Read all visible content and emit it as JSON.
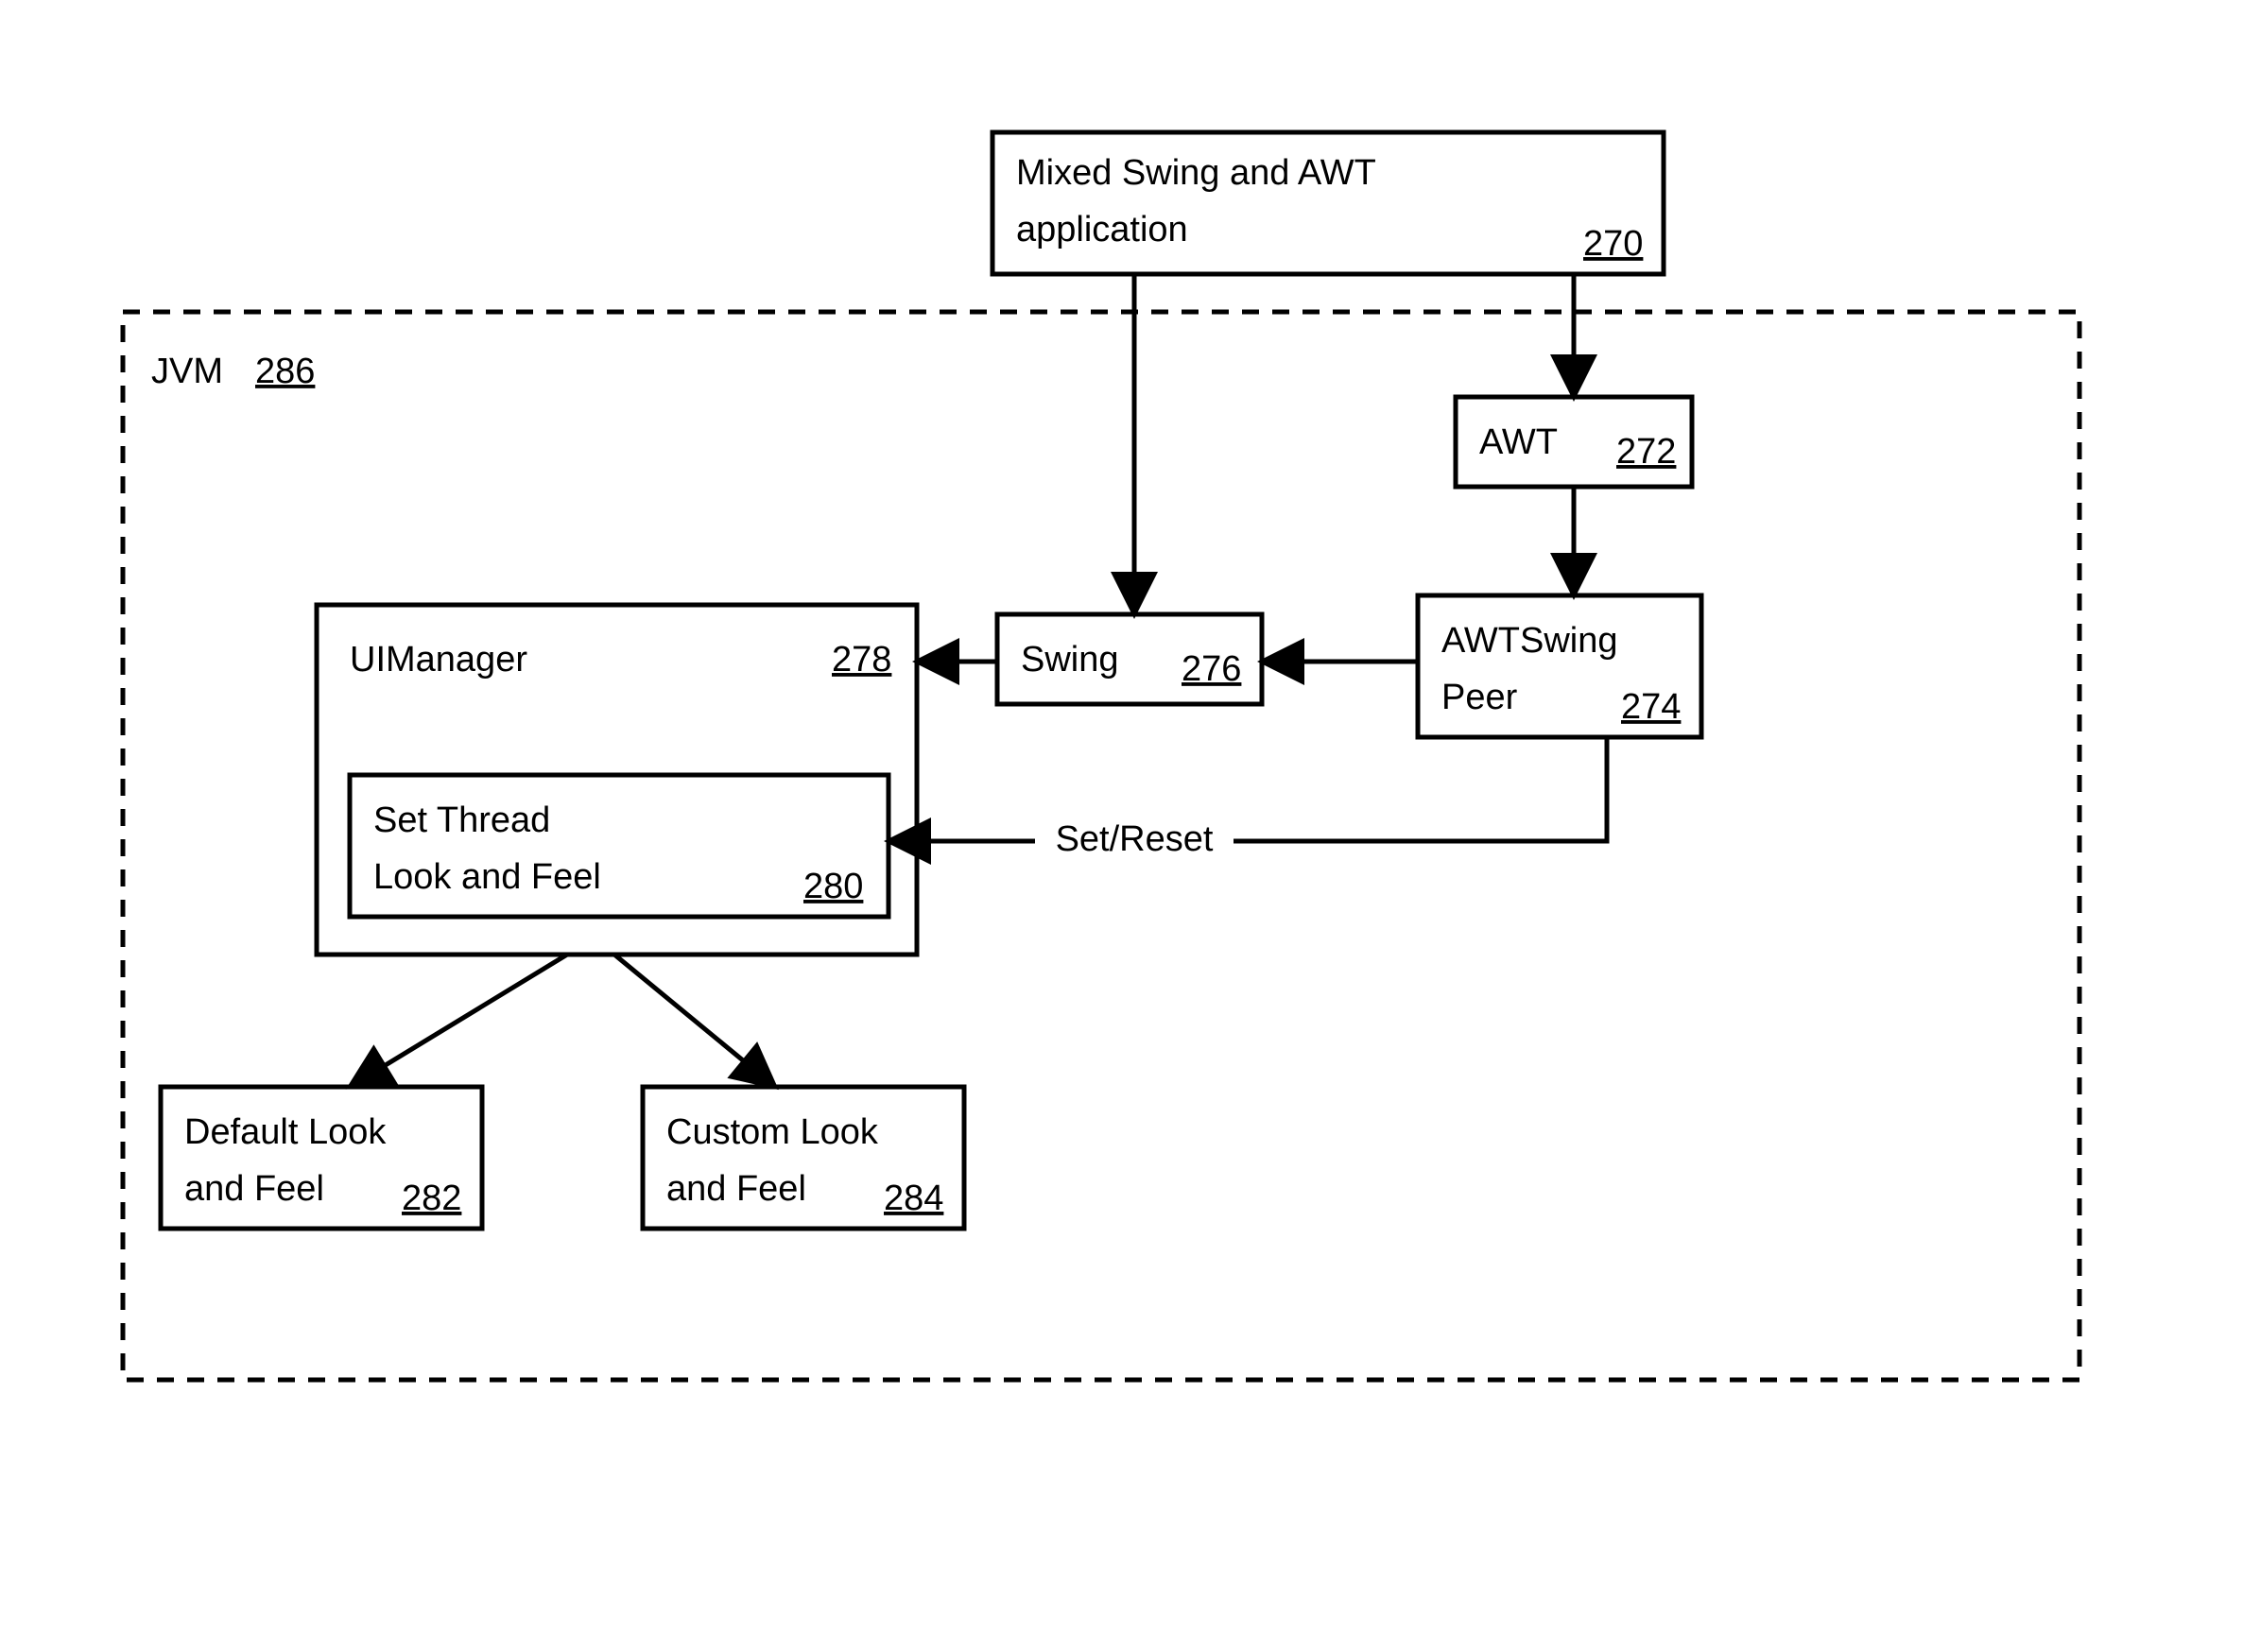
{
  "jvm": {
    "label": "JVM",
    "num": "286"
  },
  "app": {
    "label1": "Mixed Swing and AWT",
    "label2": "application",
    "num": "270"
  },
  "awt": {
    "label": "AWT",
    "num": "272"
  },
  "awtswing": {
    "label1": "AWTSwing",
    "label2": "Peer",
    "num": "274"
  },
  "swing": {
    "label": "Swing",
    "num": "276"
  },
  "uimgr": {
    "label": "UIManager",
    "num": "278"
  },
  "setlaf": {
    "label1": "Set Thread",
    "label2": "Look and Feel",
    "num": "280"
  },
  "deflaf": {
    "label1": "Default Look",
    "label2": "and Feel",
    "num": "282"
  },
  "cuslaf": {
    "label1": "Custom Look",
    "label2": "and Feel",
    "num": "284"
  },
  "edge": {
    "setreset": "Set/Reset"
  }
}
